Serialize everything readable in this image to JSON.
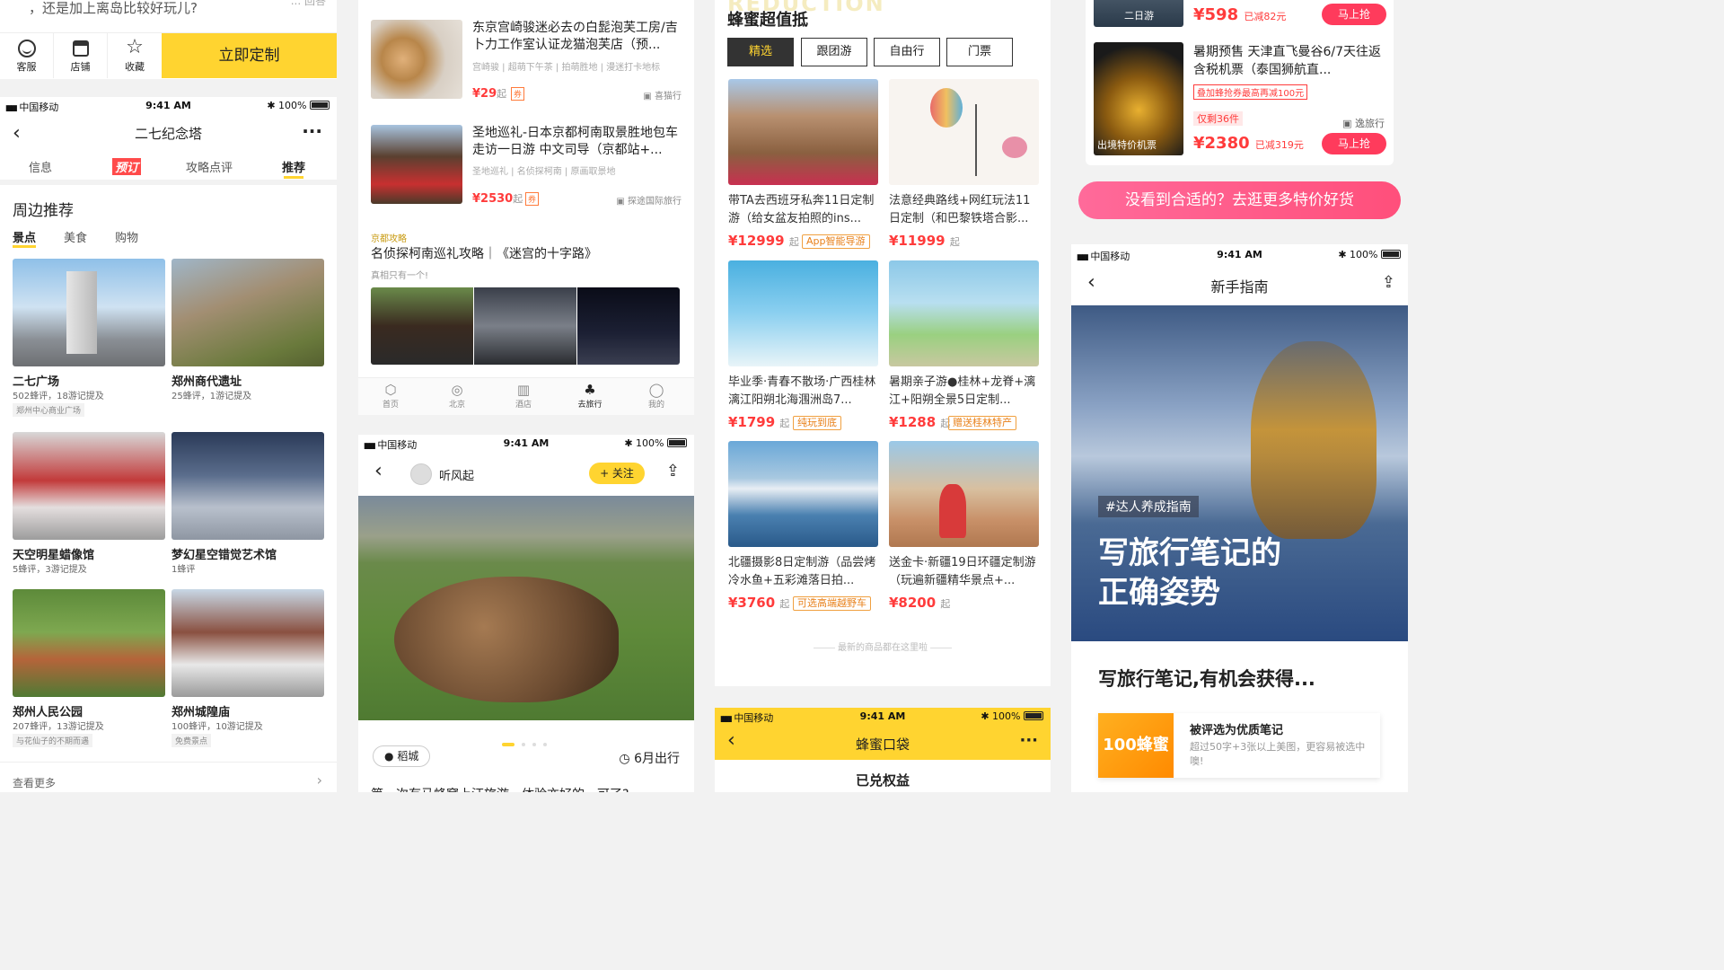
{
  "p1": {
    "top_text": "，还是加上离岛比较好玩儿?",
    "top_text_right": "... 回答",
    "bottom_bar": [
      {
        "label": "客服",
        "icon": "smile-icon"
      },
      {
        "label": "店铺",
        "icon": "store-icon"
      },
      {
        "label": "收藏",
        "icon": "star-icon"
      }
    ],
    "cta": "立即定制"
  },
  "p2": {
    "status": {
      "carrier": "中国移动",
      "time": "9:41 AM",
      "battery": "100%"
    },
    "title": "二七纪念塔",
    "tabs": [
      "信息",
      "预订",
      "攻略点评",
      "推荐"
    ],
    "section_title": "周边推荐",
    "subtabs": [
      "景点",
      "美食",
      "购物"
    ],
    "items": [
      {
        "name": "二七广场",
        "stats": "502蜂评，18游记提及",
        "tag": "郑州中心商业广场"
      },
      {
        "name": "郑州商代遗址",
        "stats": "25蜂评，1游记提及",
        "tag": ""
      },
      {
        "name": "天空明星蜡像馆",
        "stats": "5蜂评，3游记提及",
        "tag": ""
      },
      {
        "name": "梦幻星空错觉艺术馆",
        "stats": "1蜂评",
        "tag": ""
      },
      {
        "name": "郑州人民公园",
        "stats": "207蜂评，13游记提及",
        "tag": "与花仙子的不期而遇"
      },
      {
        "name": "郑州城隍庙",
        "stats": "100蜂评，10游记提及",
        "tag": "免费景点"
      }
    ],
    "see_more": "查看更多"
  },
  "p3": {
    "items": [
      {
        "title": "东京宫崎骏迷必去の白髭泡芙工房/吉卜力工作室认证龙猫泡芙店（预...",
        "sub": "宫崎骏 | 超萌下午茶 | 拍萌胜地 | 漫迷打卡地标",
        "price": "¥29",
        "unit": "起",
        "coupon": "券",
        "vendor": "喜猫行"
      },
      {
        "title": "圣地巡礼-日本京都柯南取景胜地包车走访一日游 中文司导（京都站+...",
        "sub": "圣地巡礼 | 名侦探柯南 | 原画取景地",
        "price": "¥2530",
        "unit": "起",
        "coupon": "券",
        "vendor": "探途国际旅行"
      }
    ],
    "article_tag": "京都攻略",
    "article_title": "名侦探柯南巡礼攻略｜《迷宫的十字路》",
    "article_sub": "真相只有一个!",
    "nav": [
      {
        "label": "首页",
        "icon": "home-icon"
      },
      {
        "label": "北京",
        "icon": "location-icon"
      },
      {
        "label": "酒店",
        "icon": "hotel-icon"
      },
      {
        "label": "去旅行",
        "icon": "palm-icon"
      },
      {
        "label": "我的",
        "icon": "user-icon"
      }
    ]
  },
  "p4": {
    "status": {
      "carrier": "中国移动",
      "time": "9:41 AM",
      "battery": "100%"
    },
    "user": "听风起",
    "follow": "+ 关注",
    "location": "稻城",
    "date": "6月出行",
    "caption": "第一次有马蜂窝上汪旅游，体验亦好的，可了?"
  },
  "p5": {
    "bg_text": "REDUCTION",
    "title": "蜂蜜超值抵",
    "tabs": [
      "精选",
      "跟团游",
      "自由行",
      "门票"
    ],
    "products": [
      {
        "title": "带TA去西班牙私奔11日定制游（给女盆友拍照的ins...",
        "price": "¥12999",
        "unit": "起",
        "tag": "App智能导游"
      },
      {
        "title": "法意经典路线+网红玩法11日定制（和巴黎铁塔合影...",
        "price": "¥11999",
        "unit": "起",
        "tag": ""
      },
      {
        "title": "毕业季·青春不散场·广西桂林漓江阳朔北海涠洲岛7...",
        "price": "¥1799",
        "unit": "起",
        "tag": "纯玩到底"
      },
      {
        "title": "暑期亲子游●桂林+龙脊+漓江+阳朔全景5日定制...",
        "price": "¥1288",
        "unit": "起",
        "tag": "赠送桂林特产"
      },
      {
        "title": "北疆摄影8日定制游（品尝烤冷水鱼+五彩滩落日拍...",
        "price": "¥3760",
        "unit": "起",
        "tag": "可选高端越野车"
      },
      {
        "title": "送金卡·新疆19日环疆定制游（玩遍新疆精华景点+...",
        "price": "¥8200",
        "unit": "起",
        "tag": ""
      }
    ],
    "footer": "最新的商品都在这里啦"
  },
  "p6": {
    "status": {
      "carrier": "中国移动",
      "time": "9:41 AM",
      "battery": "100%"
    },
    "title": "蜂蜜口袋",
    "section": "已兑权益"
  },
  "p7": {
    "top_item": {
      "badge": "二日游",
      "price": "¥598",
      "discount": "已减82元",
      "button": "马上抢"
    },
    "item": {
      "title": "暑期预售 天津直飞曼谷6/7天往返含税机票（泰国狮航直...",
      "promo": "叠加蜂抢券最高再减100元",
      "stock": "仅剩36件",
      "vendor": "逸旅行",
      "badge": "出境特价机票",
      "price": "¥2380",
      "discount": "已减319元",
      "button": "马上抢"
    },
    "banner": "没看到合适的？去逛更多特价好货"
  },
  "p8": {
    "status": {
      "carrier": "中国移动",
      "time": "9:41 AM",
      "battery": "100%"
    },
    "title": "新手指南",
    "hashtag": "#达人养成指南",
    "hero_line1": "写旅行笔记的",
    "hero_line2": "正确姿势",
    "section": "写旅行笔记,有机会获得...",
    "reward_badge": "100蜂蜜",
    "reward_title": "被评选为优质笔记",
    "reward_desc": "超过50字+3张以上美图，更容易被选中噢!"
  },
  "colors": {
    "brand_yellow": "#ffd430",
    "red": "#ff3b3b",
    "pink": "#ff4f7b"
  }
}
